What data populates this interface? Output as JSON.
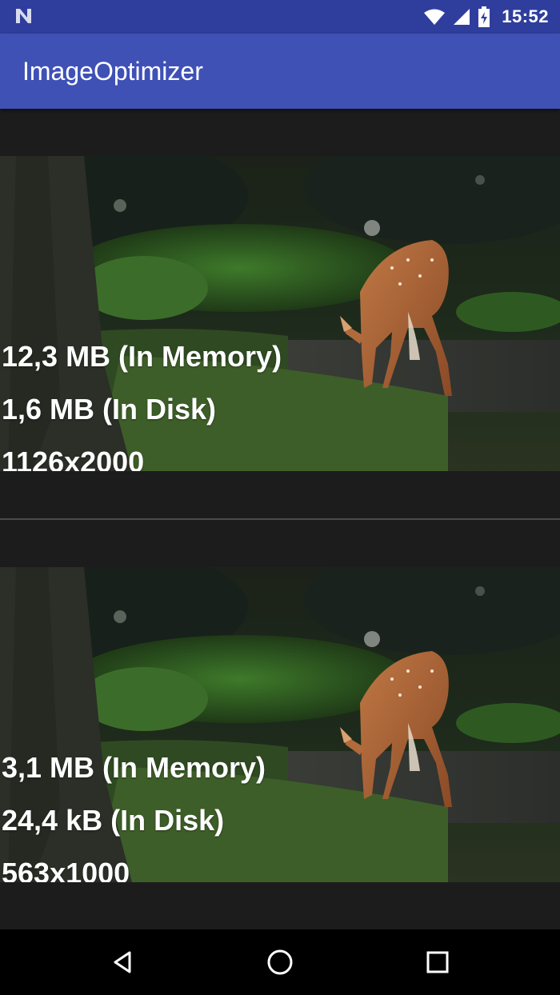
{
  "status_bar": {
    "time": "15:52",
    "icons": [
      "n-notification-icon",
      "wifi-icon",
      "signal-icon",
      "battery-icon"
    ]
  },
  "app_bar": {
    "title": "ImageOptimizer"
  },
  "images": [
    {
      "memory": "12,3 MB (In Memory)",
      "disk": "1,6 MB (In Disk)",
      "resolution": "1126x2000"
    },
    {
      "memory": "3,1 MB (In Memory)",
      "disk": "24,4 kB (In Disk)",
      "resolution": "563x1000"
    }
  ],
  "nav_bar": {
    "icons": [
      "back-icon",
      "home-icon",
      "recents-icon"
    ]
  },
  "colors": {
    "status_bar": "#2f3e9d",
    "app_bar": "#3f51b5",
    "background": "#1c1c1d"
  }
}
